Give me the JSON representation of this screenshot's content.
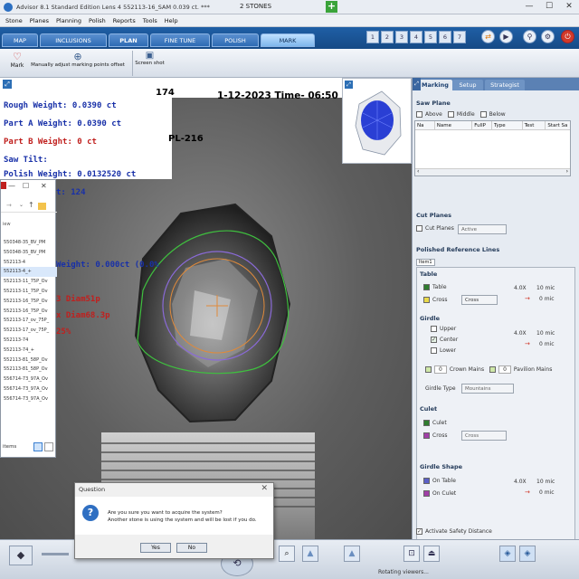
{
  "title_bar": {
    "app_title": "Advisor 8.1 Standard Edition Lens 4    552113-16_SAM   0.039 ct. ***",
    "center_title": "2 STONES",
    "minimize": "—",
    "maximize": "☐",
    "close": "✕"
  },
  "menu": [
    "Stone",
    "Planes",
    "Planning",
    "Polish",
    "Reports",
    "Tools",
    "Help"
  ],
  "tabs": [
    "MAP",
    "INCLUSIONS",
    "PLAN",
    "FINE TUNE",
    "POLISH",
    "MARK"
  ],
  "number_buttons": [
    "1",
    "2",
    "3",
    "4",
    "5",
    "6",
    "7"
  ],
  "toolbar": {
    "mark_label": "Mark",
    "adjust_label": "Manually adjust marking points offset",
    "screenshot_label": "Screen shot"
  },
  "overlay": {
    "frame_number": "174",
    "date_time": "1-12-2023 Time- 06:50",
    "rough_weight": "Rough Weight: 0.0390 ct",
    "part_a": "Part A Weight: 0.0390 ct",
    "part_b": "Part B Weight: 0 ct",
    "plan_code": "PL-216",
    "saw_tilt": "Saw Tilt:",
    "polish_weight": "Polish Weight: 0.0132520 ct",
    "frag_1": "t: 124",
    "frag_2": "Weight: 0.000ct (0.0%",
    "frag_3": "3 Diam51p",
    "frag_4": "x Diam68.3p",
    "frag_5": "25%"
  },
  "explorer": {
    "items": [
      "550348-35_BV_PM",
      "550348-35_BV_PM",
      "552113-4",
      "552113-4_+",
      "552113-11_75P_Ov",
      "552113-11_75P_Ov",
      "552113-16_75P_Ov",
      "552113-16_75P_Ov",
      "552113-17_ov_75P_",
      "552113-17_ov_75P_",
      "552113-74",
      "552113-74_+",
      "552113-81_58P_Ov",
      "552113-81_58P_Ov",
      "556714-73_97A_Ov",
      "556714-73_97A_Ov",
      "556714-73_97A_Ov"
    ],
    "status": "items",
    "header_left": "iew"
  },
  "right_panel": {
    "tabs": [
      "Marking",
      "Setup",
      "Strategist"
    ],
    "saw_plane": {
      "title": "Saw Plane",
      "options": [
        "Above",
        "Middle",
        "Below"
      ],
      "columns": [
        "Na",
        "Name",
        "FullP",
        "Type",
        "Test",
        "Start Sa"
      ]
    },
    "cut_planes": {
      "title": "Cut Planes",
      "checkbox": "Cut Planes",
      "select": "Active"
    },
    "ref_lines": {
      "title": "Polished Reference Lines",
      "tab": "Item1",
      "table_title": "Table",
      "table_check": "Table",
      "cross_check": "Cross",
      "cross_select": "Cross",
      "val_4x": "4.0X",
      "val_10mic": "10 mic",
      "val_0mic": "0 mic",
      "girdle_title": "Girdle",
      "upper": "Upper",
      "center": "Center",
      "lower": "Lower",
      "crown_mains": "Crown Mains",
      "pavilion_mains": "Pavilion Mains",
      "zero": "0",
      "girdle_type_label": "Girdle Type",
      "girdle_type_value": "Mountains",
      "culet_title": "Culet",
      "culet_check": "Culet",
      "culet_cross": "Cross",
      "culet_cross_select": "Cross",
      "shape_title": "Girdle Shape",
      "on_table": "On Table",
      "on_culet": "On Culet"
    },
    "safety": "Activate Safety Distance"
  },
  "dialog": {
    "title": "Question",
    "line1": "Are you sure you want to acquire the system?",
    "line2": "Another stone is using the system and will be lost if you do.",
    "yes": "Yes",
    "no": "No"
  },
  "status_bar": {
    "text": "Rotating viewers..."
  },
  "colors": {
    "accent": "#1f5fa6",
    "overlay_blue": "#1830a8",
    "overlay_red": "#c0201e",
    "overlay_black": "#000000"
  }
}
